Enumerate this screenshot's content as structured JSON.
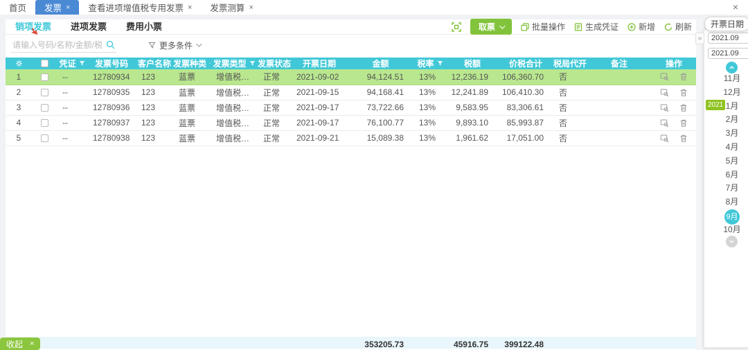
{
  "window": {
    "close_glyph": "×"
  },
  "top_tabs": [
    {
      "label": "首页",
      "active": false,
      "closable": false
    },
    {
      "label": "发票",
      "active": true,
      "closable": true
    },
    {
      "label": "查看进项增值税专用发票",
      "active": false,
      "closable": true
    },
    {
      "label": "发票测算",
      "active": false,
      "closable": true
    }
  ],
  "sub_tabs": [
    {
      "label": "销项发票",
      "active": true
    },
    {
      "label": "进项发票",
      "active": false
    },
    {
      "label": "费用小票",
      "active": false
    }
  ],
  "search": {
    "placeholder": "请输入号码/名称/金额/税额..",
    "more_filters_label": "更多条件"
  },
  "toolbar": {
    "get_invoice_label": "取票",
    "batch_label": "批量操作",
    "voucher_label": "生成凭证",
    "add_label": "新增",
    "refresh_label": "刷新"
  },
  "date_panel": {
    "title": "开票日期",
    "date_from": "2021.09",
    "date_to": "2021.09",
    "year_badge": "2021",
    "badge_month": "1月",
    "selected_month": "9月",
    "months": [
      "11月",
      "12月",
      "1月",
      "2月",
      "3月",
      "4月",
      "5月",
      "6月",
      "7月",
      "8月",
      "9月",
      "10月"
    ]
  },
  "table": {
    "headers": [
      {
        "label": "",
        "icon": "gear"
      },
      {
        "label": "",
        "icon": "checkbox"
      },
      {
        "label": "凭证",
        "filter": true
      },
      {
        "label": "发票号码",
        "filter": false
      },
      {
        "label": "客户名称",
        "filter": false
      },
      {
        "label": "发票种类",
        "filter": true
      },
      {
        "label": "发票类型",
        "filter": true
      },
      {
        "label": "发票状态",
        "filter": false
      },
      {
        "label": "开票日期",
        "filter": false
      },
      {
        "label": "金额",
        "filter": false
      },
      {
        "label": "税率",
        "filter": true
      },
      {
        "label": "税额",
        "filter": false
      },
      {
        "label": "价税合计",
        "filter": false
      },
      {
        "label": "税局代开",
        "filter": false
      },
      {
        "label": "备注",
        "filter": false
      },
      {
        "label": "操作",
        "filter": false
      }
    ],
    "rows": [
      {
        "index": "1",
        "voucher": "--",
        "invoice_no": "12780934",
        "customer": "123",
        "kind": "蓝票",
        "type": "增值税专用...",
        "status": "正常",
        "date": "2021-09-02",
        "amount": "94,124.51",
        "tax_rate": "13%",
        "tax": "12,236.19",
        "total": "106,360.70",
        "agency": "否",
        "remark": "",
        "selected": true
      },
      {
        "index": "2",
        "voucher": "--",
        "invoice_no": "12780935",
        "customer": "123",
        "kind": "蓝票",
        "type": "增值税专用...",
        "status": "正常",
        "date": "2021-09-15",
        "amount": "94,168.41",
        "tax_rate": "13%",
        "tax": "12,241.89",
        "total": "106,410.30",
        "agency": "否",
        "remark": "",
        "selected": false
      },
      {
        "index": "3",
        "voucher": "--",
        "invoice_no": "12780936",
        "customer": "123",
        "kind": "蓝票",
        "type": "增值税专用...",
        "status": "正常",
        "date": "2021-09-17",
        "amount": "73,722.66",
        "tax_rate": "13%",
        "tax": "9,583.95",
        "total": "83,306.61",
        "agency": "否",
        "remark": "",
        "selected": false
      },
      {
        "index": "4",
        "voucher": "--",
        "invoice_no": "12780937",
        "customer": "123",
        "kind": "蓝票",
        "type": "增值税专用...",
        "status": "正常",
        "date": "2021-09-17",
        "amount": "76,100.77",
        "tax_rate": "13%",
        "tax": "9,893.10",
        "total": "85,993.87",
        "agency": "否",
        "remark": "",
        "selected": false
      },
      {
        "index": "5",
        "voucher": "--",
        "invoice_no": "12780938",
        "customer": "123",
        "kind": "蓝票",
        "type": "增值税专用...",
        "status": "正常",
        "date": "2021-09-21",
        "amount": "15,089.38",
        "tax_rate": "13%",
        "tax": "1,961.62",
        "total": "17,051.00",
        "agency": "否",
        "remark": "",
        "selected": false
      }
    ],
    "totals": {
      "amount": "353205.73",
      "tax": "45916.75",
      "total": "399122.48"
    }
  },
  "footer_badge": {
    "label": "收起",
    "close_glyph": "×"
  }
}
